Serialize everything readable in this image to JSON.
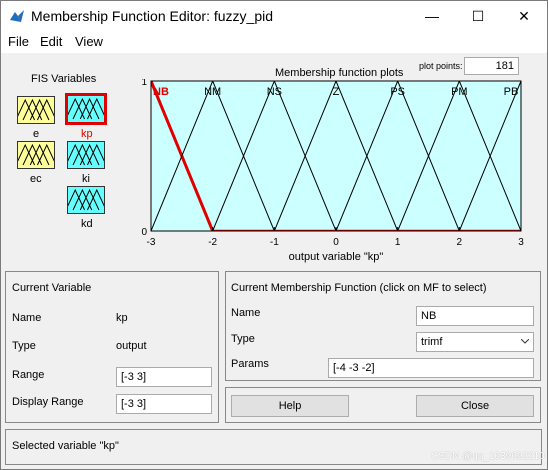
{
  "window": {
    "title": "Membership Function Editor: fuzzy_pid",
    "controls": {
      "minimize": "—",
      "maximize": "☐",
      "close": "✕"
    }
  },
  "menu": [
    "File",
    "Edit",
    "View"
  ],
  "fis": {
    "title": "FIS Variables",
    "inputs": [
      "e",
      "ec"
    ],
    "outputs": [
      "kp",
      "ki",
      "kd"
    ],
    "selected": "kp",
    "colors": {
      "input": "#ffff99",
      "output": "#66ffff",
      "selected_border": "#e00000"
    }
  },
  "plot": {
    "title": "Membership function plots",
    "plot_points_label": "plot points:",
    "plot_points_value": "181",
    "xlabel": "output variable \"kp\"",
    "xticks": [
      "-3",
      "-2",
      "-1",
      "0",
      "1",
      "2",
      "3"
    ],
    "yticks": [
      "0",
      "1"
    ],
    "background": "#ccffff",
    "selected_color": "#e00000",
    "mf_color": "#000000"
  },
  "chart_data": {
    "type": "line",
    "xlim": [
      -3,
      3
    ],
    "ylim": [
      0,
      1
    ],
    "xlabel": "output variable \"kp\"",
    "series": [
      {
        "name": "NB",
        "params": [
          -4,
          -3,
          -2
        ],
        "selected": true
      },
      {
        "name": "NM",
        "params": [
          -3,
          -2,
          -1
        ]
      },
      {
        "name": "NS",
        "params": [
          -2,
          -1,
          0
        ]
      },
      {
        "name": "Z",
        "params": [
          -1,
          0,
          1
        ]
      },
      {
        "name": "PS",
        "params": [
          0,
          1,
          2
        ]
      },
      {
        "name": "PM",
        "params": [
          1,
          2,
          3
        ]
      },
      {
        "name": "PB",
        "params": [
          2,
          3,
          4
        ]
      }
    ]
  },
  "current_variable": {
    "heading": "Current Variable",
    "name_label": "Name",
    "name_value": "kp",
    "type_label": "Type",
    "type_value": "output",
    "range_label": "Range",
    "range_value": "[-3 3]",
    "display_range_label": "Display Range",
    "display_range_value": "[-3 3]"
  },
  "current_mf": {
    "heading": "Current Membership Function (click on MF to select)",
    "name_label": "Name",
    "name_value": "NB",
    "type_label": "Type",
    "type_value": "trimf",
    "params_label": "Params",
    "params_value": "[-4 -3 -2]"
  },
  "buttons": {
    "help": "Help",
    "close": "Close"
  },
  "status": "Selected variable \"kp\"",
  "watermark": "CSDN @qq_1039692210"
}
